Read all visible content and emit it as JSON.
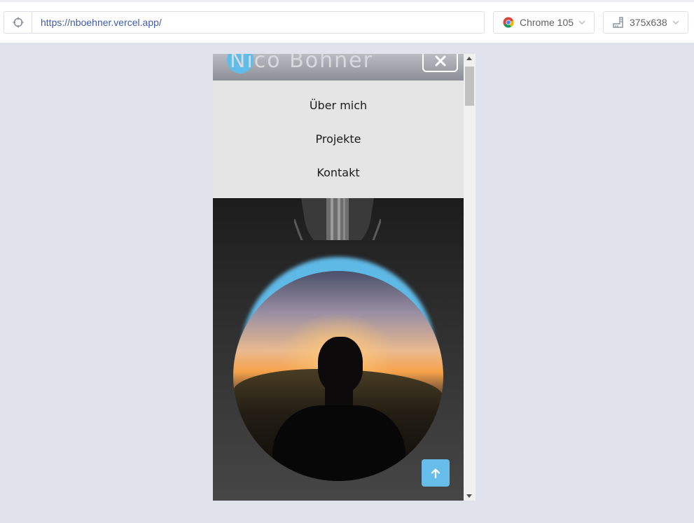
{
  "toolbar": {
    "url": "https://nboehner.vercel.app/",
    "browser": "Chrome 105",
    "viewport_size": "375x638",
    "icons": [
      "crosshair-icon",
      "chrome-icon",
      "chevron-down-icon",
      "device-size-icon"
    ]
  },
  "site": {
    "logo_text": "Nico Böhner",
    "logo_color": "#61bde8",
    "close_icon": "close-icon",
    "nav": [
      {
        "label": "Über mich"
      },
      {
        "label": "Projekte"
      },
      {
        "label": "Kontakt"
      }
    ],
    "scroll_top_icon": "arrow-up-icon",
    "accent": "#66bde9",
    "hero_caption": ""
  }
}
